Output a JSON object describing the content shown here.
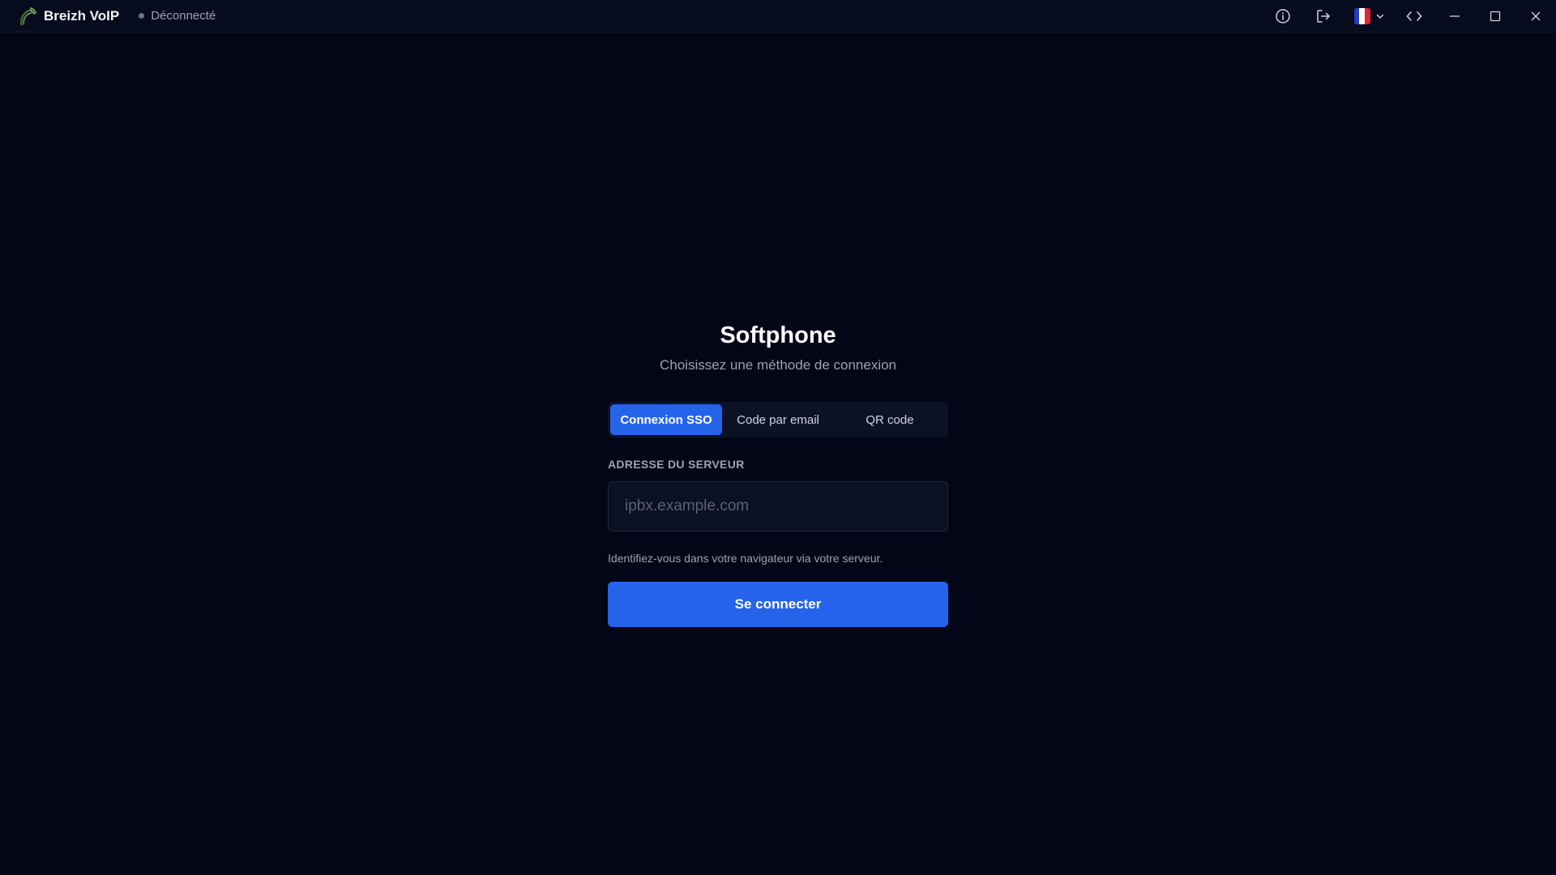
{
  "app": {
    "name": "Breizh VoIP",
    "status": "Déconnecté"
  },
  "titlebar": {
    "icons": [
      "info-icon",
      "logout-icon",
      "flag-france-icon",
      "chevron-down-icon",
      "code-icon",
      "minimize-icon",
      "maximize-icon",
      "close-icon"
    ],
    "flag_colors": [
      "#1f3fbf",
      "#ffffff",
      "#e0262f"
    ]
  },
  "login": {
    "title": "Softphone",
    "subtitle": "Choisissez une méthode de connexion",
    "tabs": [
      {
        "label": "Connexion SSO",
        "active": true
      },
      {
        "label": "Code par email",
        "active": false
      },
      {
        "label": "QR code",
        "active": false
      }
    ],
    "server_label": "ADRESSE DU SERVEUR",
    "server_value": "",
    "server_placeholder": "ipbx.example.com",
    "help_text": "Identifiez-vous dans votre navigateur via votre serveur.",
    "connect_label": "Se connecter"
  },
  "colors": {
    "background": "#030617",
    "accent": "#2563eb",
    "status_dot": "#6b7280"
  }
}
